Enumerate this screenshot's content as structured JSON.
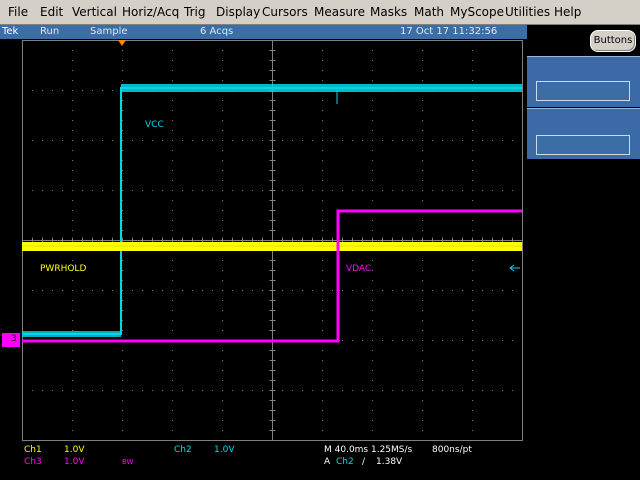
{
  "menu": {
    "items": [
      "File",
      "Edit",
      "Vertical",
      "Horiz/Acq",
      "Trig",
      "Display",
      "Cursors",
      "Measure",
      "Masks",
      "Math",
      "MyScope",
      "Utilities",
      "Help"
    ]
  },
  "status": {
    "brand": "Tek",
    "state": "Run",
    "mode": "Sample",
    "acqs": "6 Acqs",
    "datetime": "17 Oct 17 11:32:56"
  },
  "side": {
    "buttons_label": "Buttons"
  },
  "traces": {
    "vcc": "VCC",
    "pwrhold": "PWRHOLD",
    "vdac": "VDAC",
    "ch3_marker": "3"
  },
  "readouts": {
    "ch1_name": "Ch1",
    "ch1_scale": "1.0V",
    "ch3_name": "Ch3",
    "ch3_scale": "1.0V",
    "bw": "BW",
    "ch2_name": "Ch2",
    "ch2_scale": "1.0V",
    "timebase": "M 40.0ms 1.25MS/s",
    "resolution": "800ns/pt",
    "trigger_prefix": "A",
    "trigger_source": "Ch2",
    "trigger_slope": "∕",
    "trigger_level": "1.38V"
  },
  "colors": {
    "ch1": "#ffff00",
    "ch2": "#00d8e8",
    "ch3": "#ff00ff",
    "grid": "#808080",
    "status_bg": "#3a6ea5"
  }
}
